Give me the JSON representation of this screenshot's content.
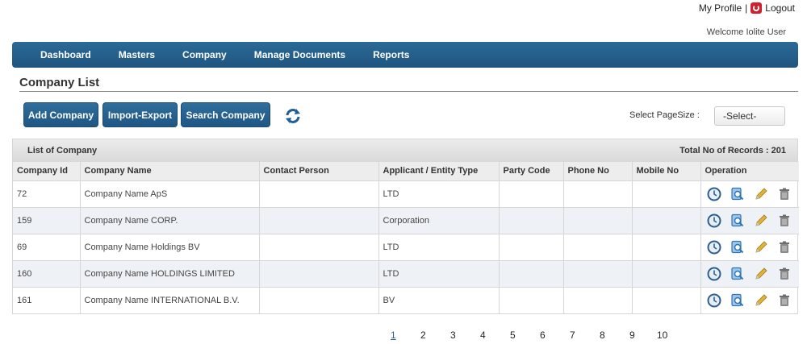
{
  "header": {
    "my_profile": "My Profile",
    "separator": "|",
    "logout": "Logout",
    "welcome": "Welcome Iolite User"
  },
  "nav": {
    "items": [
      {
        "label": "Dashboard"
      },
      {
        "label": "Masters"
      },
      {
        "label": "Company"
      },
      {
        "label": "Manage Documents"
      },
      {
        "label": "Reports"
      }
    ]
  },
  "page": {
    "title": "Company List"
  },
  "toolbar": {
    "add_label": "Add Company",
    "import_label": "Import-Export",
    "search_label": "Search Company",
    "pagesize_label": "Select PageSize :",
    "pagesize_value": "-Select-"
  },
  "grid": {
    "caption": "List of Company",
    "total": "Total No of Records : 201",
    "columns": [
      "Company Id",
      "Company Name",
      "Contact Person",
      "Applicant / Entity Type",
      "Party Code",
      "Phone No",
      "Mobile No",
      "Operation"
    ],
    "rows": [
      {
        "id": "72",
        "name": "Company Name ApS",
        "contact": "",
        "type": "LTD",
        "party": "",
        "phone": "",
        "mobile": ""
      },
      {
        "id": "159",
        "name": "Company Name CORP.",
        "contact": "",
        "type": "Corporation",
        "party": "",
        "phone": "",
        "mobile": ""
      },
      {
        "id": "69",
        "name": "Company Name Holdings BV",
        "contact": "",
        "type": "LTD",
        "party": "",
        "phone": "",
        "mobile": ""
      },
      {
        "id": "160",
        "name": "Company Name HOLDINGS LIMITED",
        "contact": "",
        "type": "LTD",
        "party": "",
        "phone": "",
        "mobile": ""
      },
      {
        "id": "161",
        "name": "Company Name INTERNATIONAL B.V.",
        "contact": "",
        "type": "BV",
        "party": "",
        "phone": "",
        "mobile": ""
      }
    ],
    "operation_icons": [
      "history-icon",
      "view-icon",
      "edit-icon",
      "delete-icon"
    ]
  },
  "pagination": {
    "pages": [
      "1",
      "2",
      "3",
      "4",
      "5",
      "6",
      "7",
      "8",
      "9",
      "10"
    ],
    "current": "1"
  },
  "colors": {
    "nav_bg": "#1f557f",
    "button_bg": "#2f6e9c",
    "logout_red": "#d0202e",
    "alt_row": "#eef2f7"
  }
}
